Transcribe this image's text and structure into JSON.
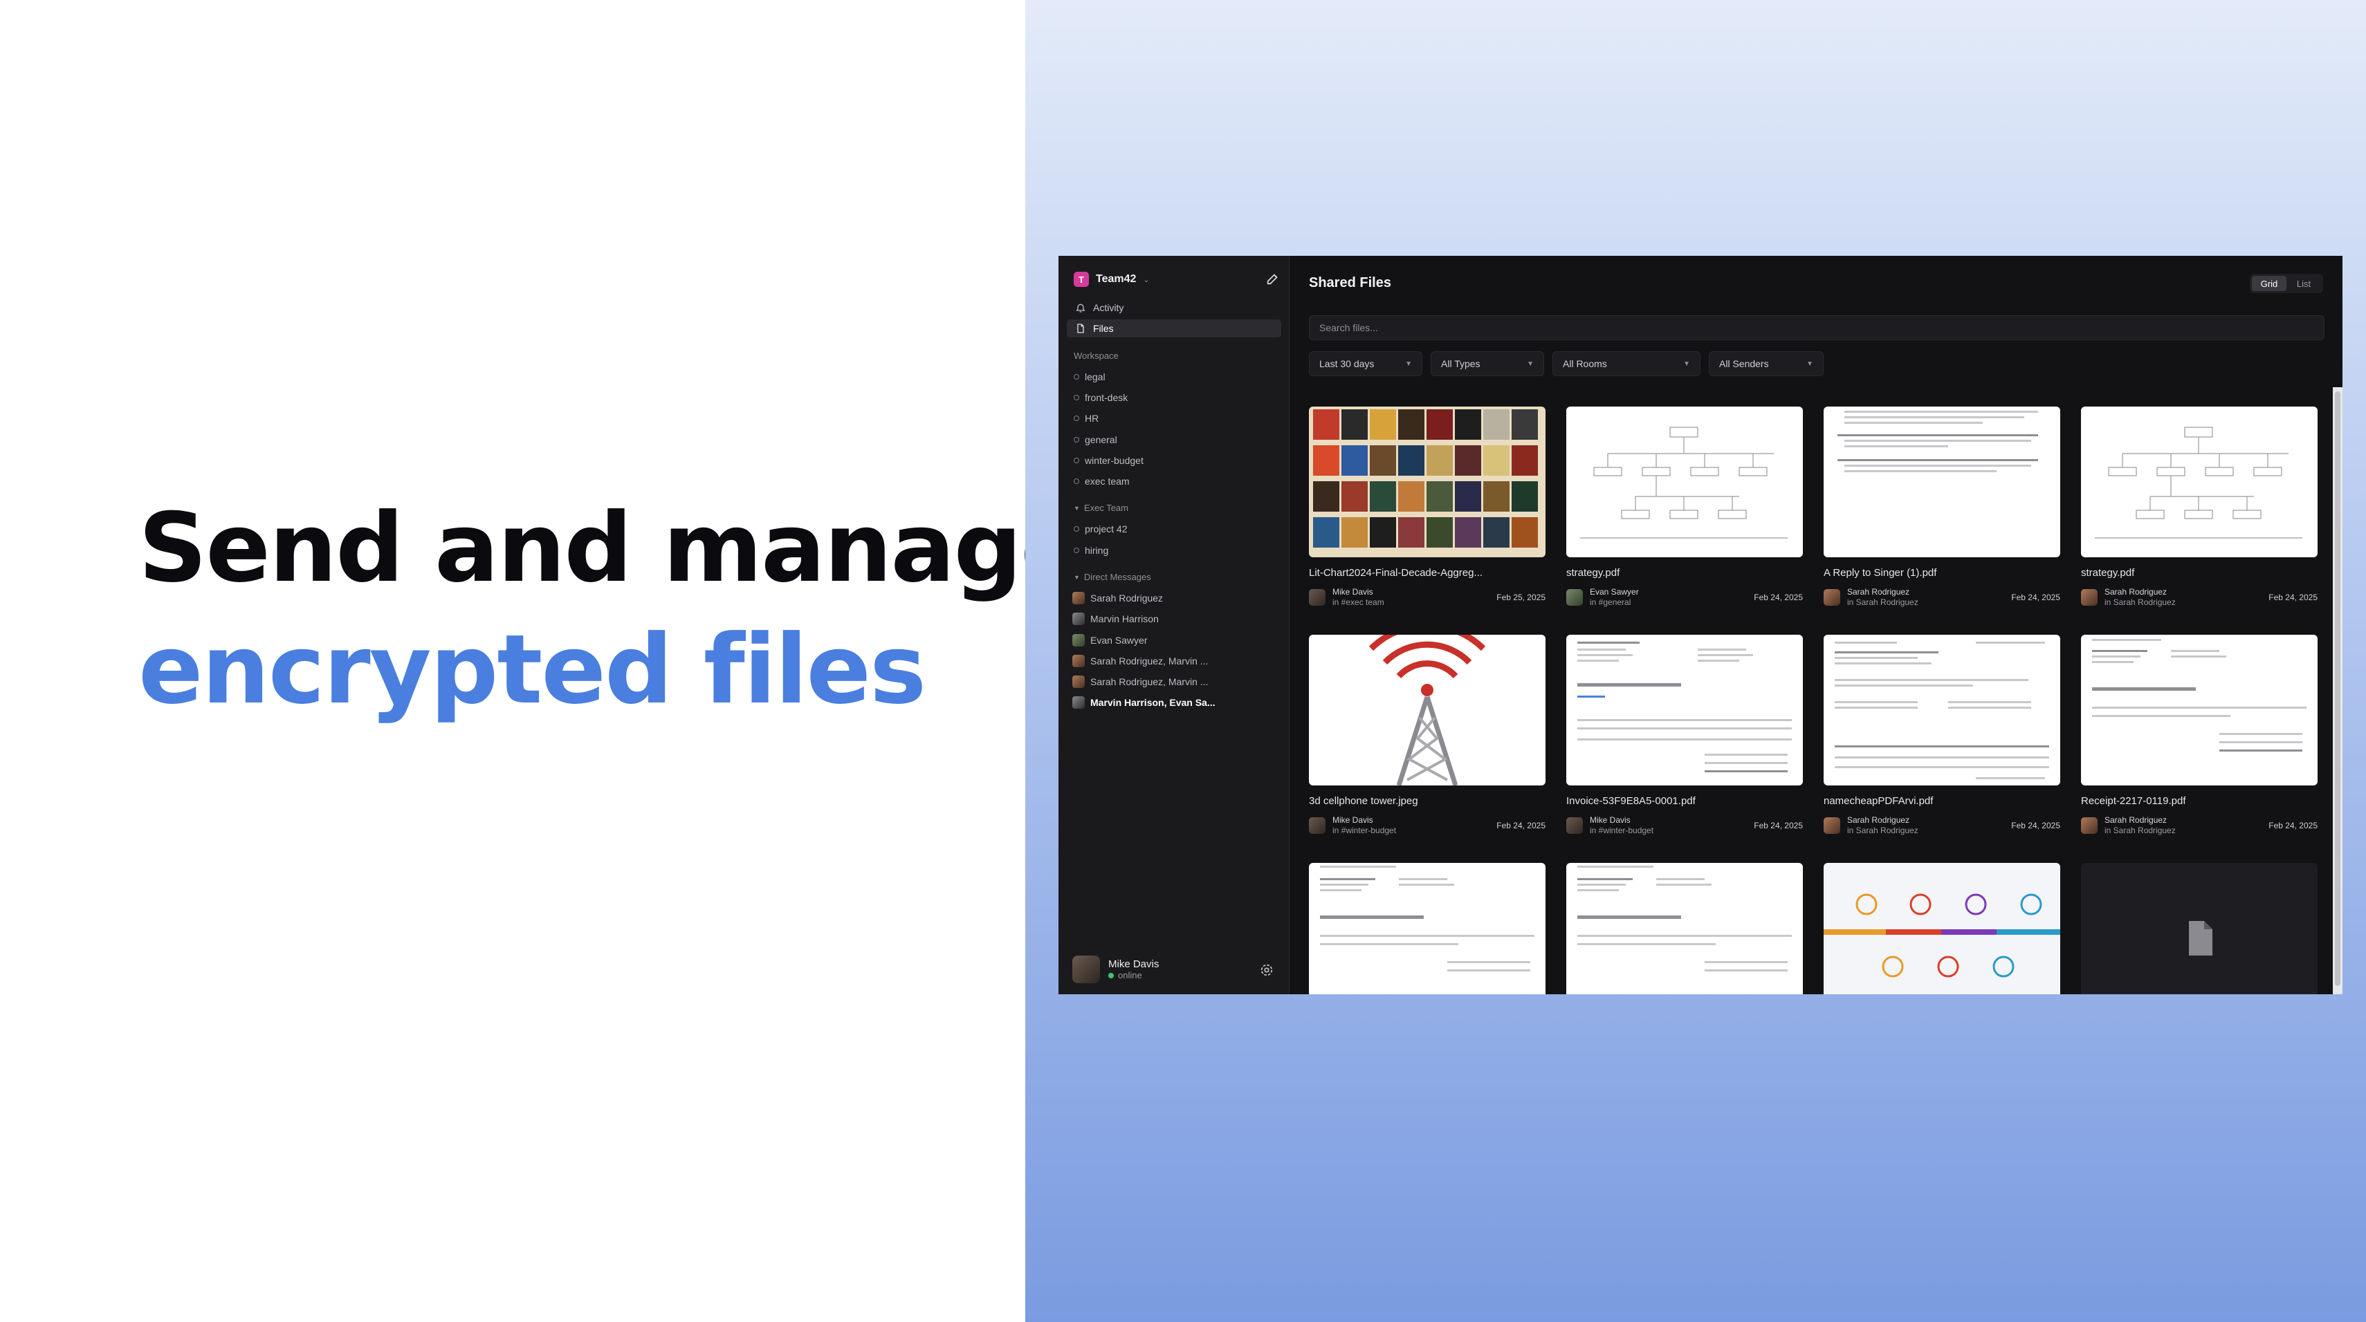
{
  "promo": {
    "line1": "Send and manage",
    "line2": "encrypted files"
  },
  "colors": {
    "accent": "#4a7fe0",
    "workspace_logo": "#d63a9b",
    "online": "#3ec46d"
  },
  "workspace": {
    "logo_letter": "T",
    "name": "Team42"
  },
  "nav": {
    "activity": "Activity",
    "files": "Files"
  },
  "sections": {
    "workspace": {
      "label": "Workspace",
      "rooms": [
        "legal",
        "front-desk",
        "HR",
        "general",
        "winter-budget",
        "exec team"
      ]
    },
    "exec": {
      "label": "Exec Team",
      "rooms": [
        "project 42",
        "hiring"
      ]
    },
    "dms": {
      "label": "Direct Messages",
      "items": [
        "Sarah Rodriguez",
        "Marvin Harrison",
        "Evan Sawyer",
        "Sarah Rodriguez, Marvin ...",
        "Sarah Rodriguez, Marvin ...",
        "Marvin Harrison, Evan Sa..."
      ]
    }
  },
  "user": {
    "name": "Mike Davis",
    "status": "online"
  },
  "main": {
    "title": "Shared Files",
    "view": {
      "grid": "Grid",
      "list": "List"
    },
    "search_placeholder": "Search files...",
    "filters": [
      "Last 30 days",
      "All Types",
      "All Rooms",
      "All Senders"
    ]
  },
  "files": [
    {
      "name": "Lit-Chart2024-Final-Decade-Aggreg...",
      "sender": "Mike Davis",
      "room": "in #exec team",
      "date": "Feb 25, 2025"
    },
    {
      "name": "strategy.pdf",
      "sender": "Evan Sawyer",
      "room": "in #general",
      "date": "Feb 24, 2025"
    },
    {
      "name": "A Reply to Singer (1).pdf",
      "sender": "Sarah Rodriguez",
      "room": "in Sarah Rodriguez",
      "date": "Feb 24, 2025"
    },
    {
      "name": "strategy.pdf",
      "sender": "Sarah Rodriguez",
      "room": "in Sarah Rodriguez",
      "date": "Feb 24, 2025"
    },
    {
      "name": "3d cellphone tower.jpeg",
      "sender": "Mike Davis",
      "room": "in #winter-budget",
      "date": "Feb 24, 2025"
    },
    {
      "name": "Invoice-53F9E8A5-0001.pdf",
      "sender": "Mike Davis",
      "room": "in #winter-budget",
      "date": "Feb 24, 2025"
    },
    {
      "name": "namecheapPDFArvi.pdf",
      "sender": "Sarah Rodriguez",
      "room": "in Sarah Rodriguez",
      "date": "Feb 24, 2025"
    },
    {
      "name": "Receipt-2217-0119.pdf",
      "sender": "Sarah Rodriguez",
      "room": "in Sarah Rodriguez",
      "date": "Feb 24, 2025"
    }
  ]
}
